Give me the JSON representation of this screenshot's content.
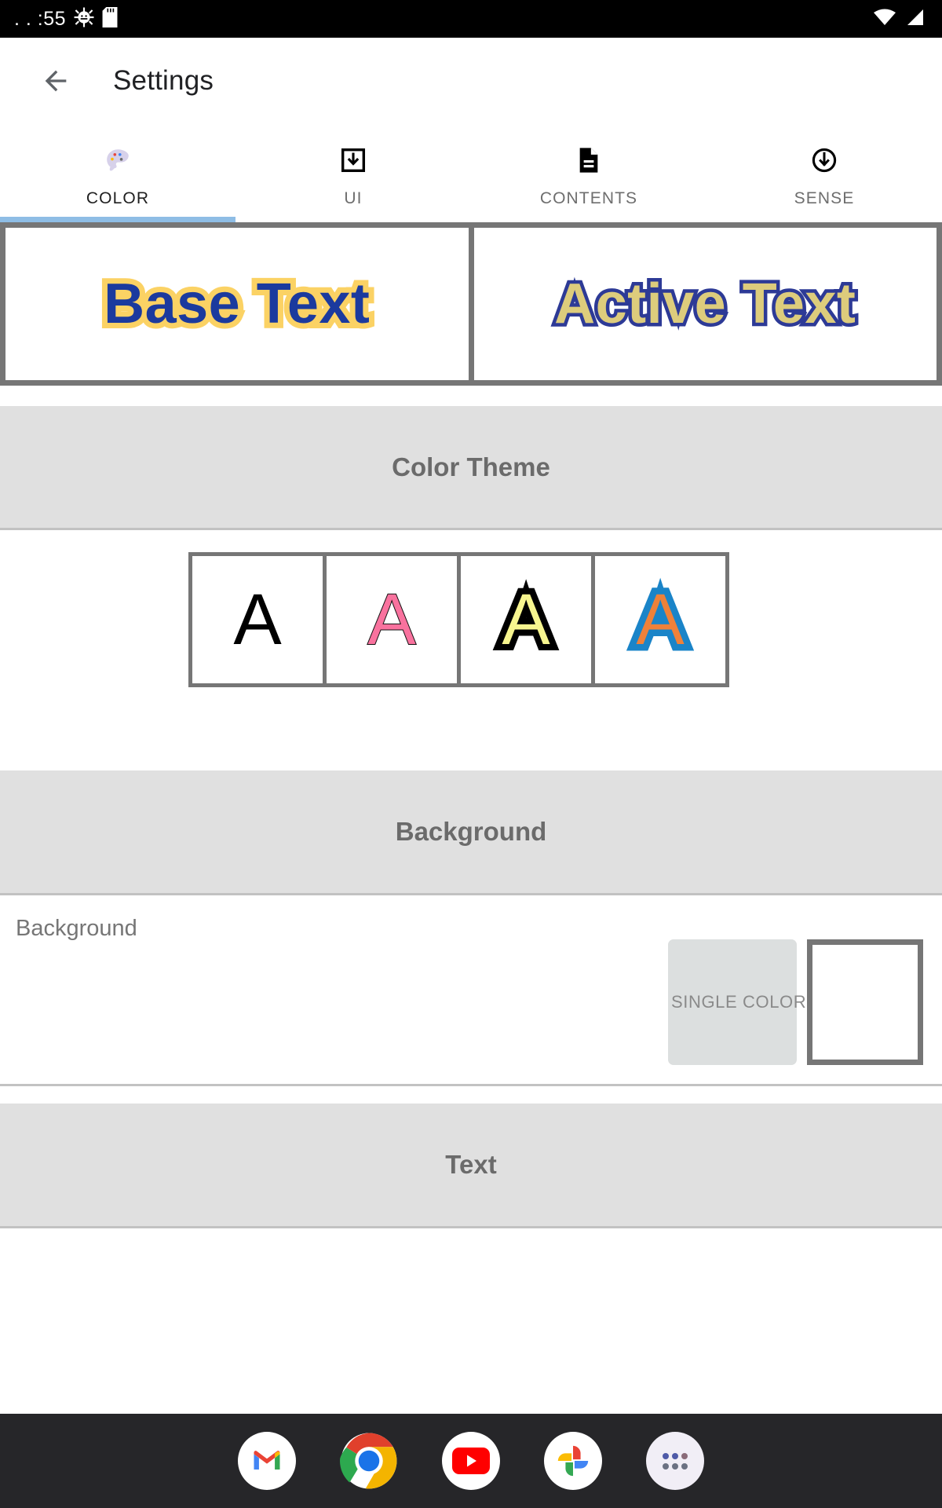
{
  "status_bar": {
    "clock": ". . :55",
    "left_icons": [
      "android-gear-icon",
      "sd-card-icon"
    ],
    "right_icons": [
      "wifi-icon",
      "cellular-signal-icon"
    ],
    "background": "#000000"
  },
  "app_bar": {
    "back_icon": "back-arrow-icon",
    "title": "Settings"
  },
  "tabs": {
    "active_index": 0,
    "indicator_color": "#8EBDE5",
    "items": [
      {
        "label": "COLOR",
        "icon": "palette-icon"
      },
      {
        "label": "UI",
        "icon": "download-box-icon"
      },
      {
        "label": "CONTENTS",
        "icon": "document-icon"
      },
      {
        "label": "SENSE",
        "icon": "circle-down-arrow-icon"
      }
    ]
  },
  "preview": {
    "base": {
      "text": "Base Text",
      "fill_color": "#1B3A9E",
      "outline_color": "#FBD264"
    },
    "active": {
      "text": "Active Text",
      "fill_color": "#DDCC7C",
      "outline_color": "#2D3A96"
    }
  },
  "sections": {
    "color_theme": {
      "title": "Color Theme"
    },
    "background": {
      "title": "Background"
    },
    "text": {
      "title": "Text"
    }
  },
  "color_theme": {
    "swatches": [
      {
        "letter": "A",
        "fill_color": "#000000",
        "outline_color": "#000000",
        "name": "theme-black"
      },
      {
        "letter": "A",
        "fill_color": "#F9729E",
        "outline_color": "#111111",
        "name": "theme-pink"
      },
      {
        "letter": "A",
        "fill_color": "#F7F58F",
        "outline_color": "#000000",
        "name": "theme-yellow-black"
      },
      {
        "letter": "A",
        "fill_color": "#EF8139",
        "outline_color": "#1A84C8",
        "name": "theme-orange-blue"
      }
    ]
  },
  "background_row": {
    "label": "Background",
    "mode_button_label": "SINGLE COLOR",
    "swatch_color": "#FFFFFF"
  },
  "dock": {
    "apps": [
      {
        "name": "gmail-app-icon",
        "label": "Gmail"
      },
      {
        "name": "chrome-app-icon",
        "label": "Chrome"
      },
      {
        "name": "youtube-app-icon",
        "label": "YouTube"
      },
      {
        "name": "google-photos-app-icon",
        "label": "Photos"
      },
      {
        "name": "app-drawer-icon",
        "label": "All apps"
      }
    ]
  }
}
